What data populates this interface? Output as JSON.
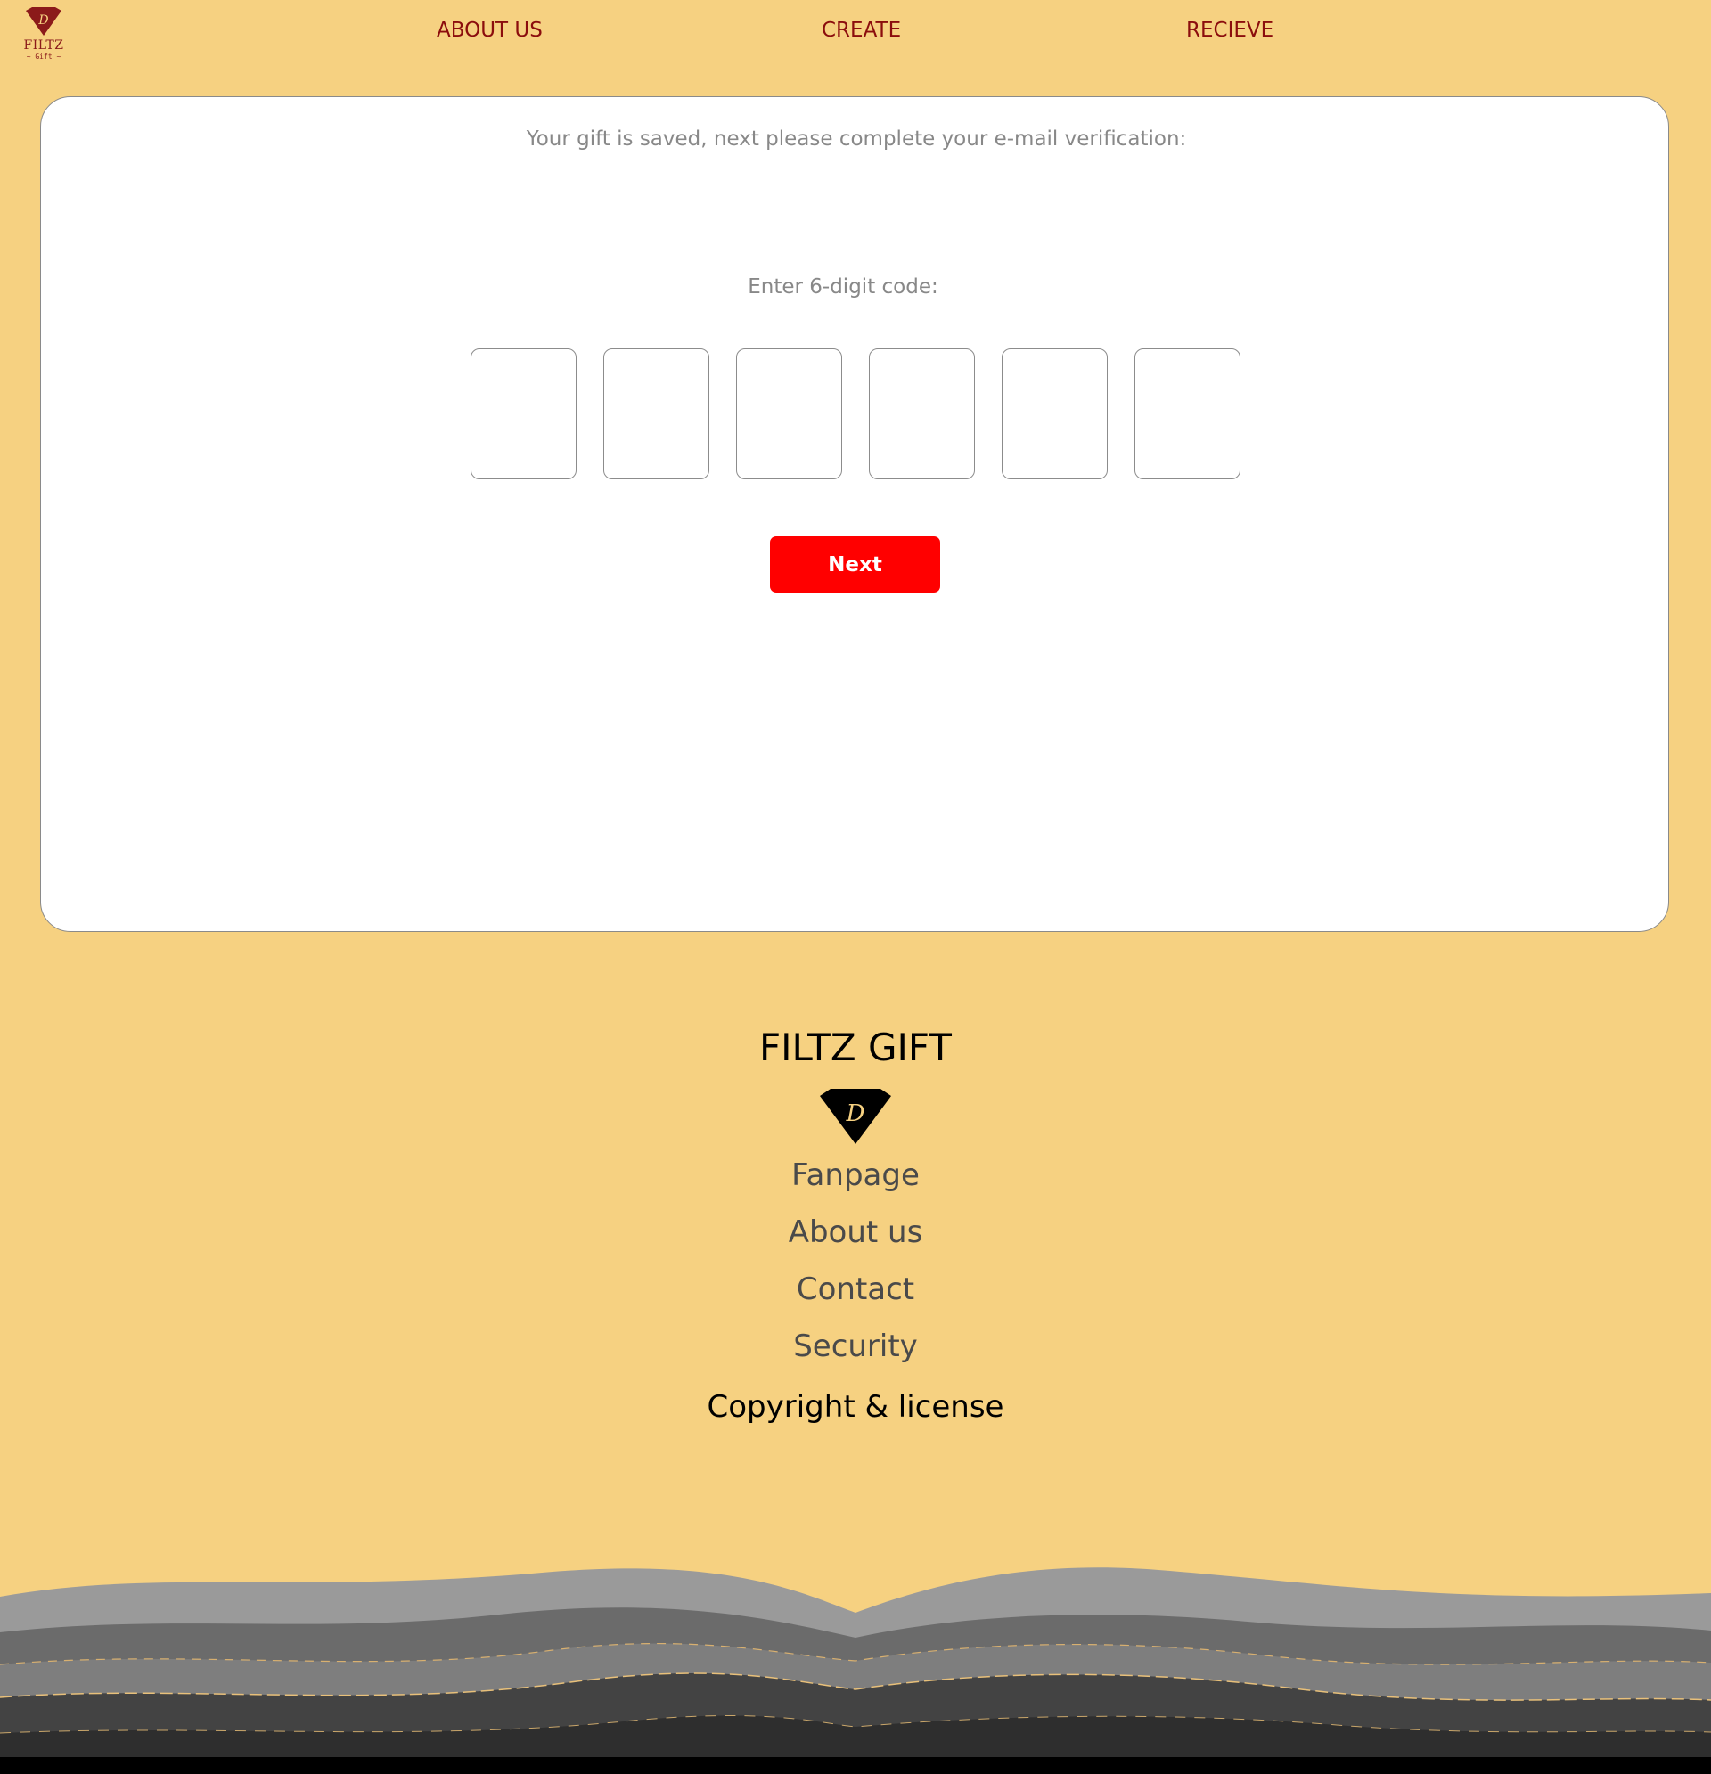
{
  "header": {
    "logo": {
      "icon": "diamond-logo-icon",
      "text": "FILTZ",
      "subtext": "~ Gift ~"
    },
    "nav": [
      {
        "label": "ABOUT US"
      },
      {
        "label": "CREATE"
      },
      {
        "label": "RECIEVE"
      }
    ]
  },
  "verification": {
    "message": "Your gift is saved, next please complete your e-mail verification:",
    "code_label": "Enter 6-digit code:",
    "code_digits": [
      "",
      "",
      "",
      "",
      "",
      ""
    ],
    "next_label": "Next"
  },
  "footer": {
    "title": "FILTZ GIFT",
    "logo_icon": "diamond-logo-icon",
    "links": [
      {
        "label": "Fanpage"
      },
      {
        "label": "About us"
      },
      {
        "label": "Contact"
      },
      {
        "label": "Security"
      }
    ],
    "copyright": "Copyright & license"
  },
  "colors": {
    "background": "#f6d181",
    "nav_text": "#8b0d0d",
    "button": "#ff0000",
    "muted_text": "#888888"
  }
}
